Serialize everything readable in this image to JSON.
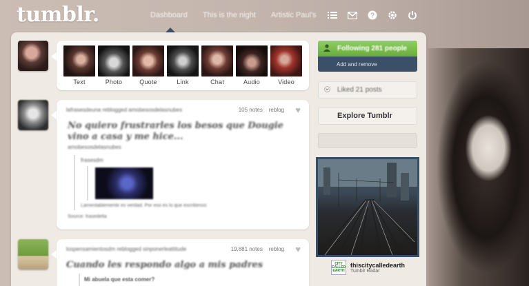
{
  "brand": {
    "logo": "tumblr."
  },
  "topnav": {
    "links": [
      "Dashboard",
      "This is the night",
      "Artistic Paul's"
    ]
  },
  "topicons": [
    "list-icon",
    "mail-icon",
    "help-icon",
    "gear-icon",
    "power-icon"
  ],
  "composer": {
    "types": [
      "Text",
      "Photo",
      "Quote",
      "Link",
      "Chat",
      "Audio",
      "Video"
    ]
  },
  "posts": [
    {
      "header": "lafrasesdeuna   reblogged   amobesosdelasnubes",
      "notes": "105 notes",
      "reblog": "reblog",
      "title": "No quiero frustrarles los besos que Dougie vino a casa y me hice...",
      "subtitle": "amobesosdelasnubes",
      "quote_from": "frasesdm",
      "caption": "Lamentablemente es verdad. Por eso es lo que escribimos",
      "source": "Source: frasedelta"
    },
    {
      "header": "lospensamientosdm   reblogged   sinponerleattitude",
      "notes": "19,881 notes",
      "reblog": "reblog",
      "title": "Cuando les respondo algo a mis padres",
      "subtitle": "Mi abuela que esta comer?"
    }
  ],
  "sidebar": {
    "following": "Following 281 people",
    "add_remove": "Add and remove",
    "liked": "Liked 21 posts",
    "explore": "Explore Tumblr"
  },
  "radar": {
    "logo_text": "CITY CALLED EARTH",
    "username": "thiscitycalledearth",
    "label": "Tumblr Radar"
  },
  "colors": {
    "nav_caret": "#3b4f66",
    "follow_green": "#6aab3c",
    "follow_blue": "#3b4f66"
  }
}
